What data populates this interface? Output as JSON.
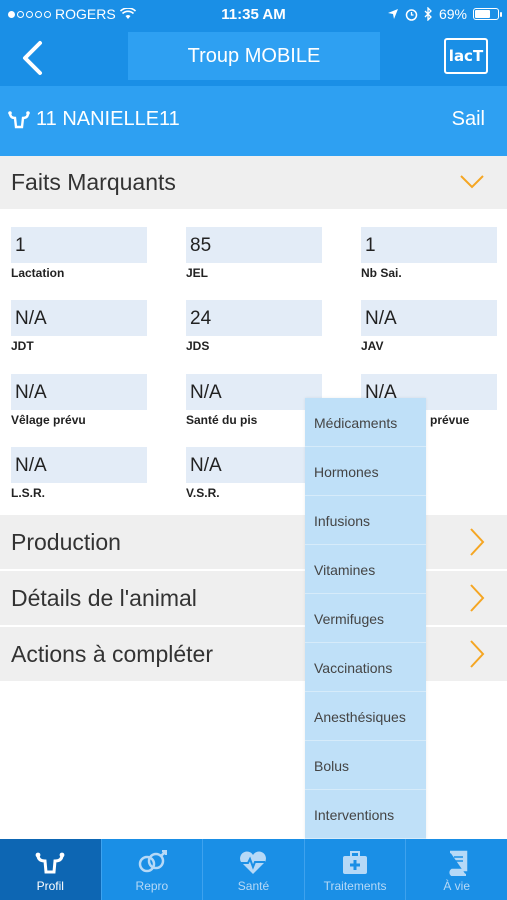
{
  "status_bar": {
    "carrier": "ROGERS",
    "time": "11:35 AM",
    "battery": "69%",
    "battery_level": 0.69
  },
  "nav": {
    "title": "Troup MOBILE",
    "logo_text": "lacT"
  },
  "animal": {
    "name": "11 NANIELLE11",
    "status": "Sail"
  },
  "faits": {
    "title": "Faits Marquants",
    "fields": [
      {
        "value": "1",
        "label": "Lactation"
      },
      {
        "value": "85",
        "label": "JEL"
      },
      {
        "value": "1",
        "label": "Nb Sai."
      },
      {
        "value": "N/A",
        "label": "JDT"
      },
      {
        "value": "24",
        "label": "JDS"
      },
      {
        "value": "N/A",
        "label": "JAV"
      },
      {
        "value": "N/A",
        "label": "Vêlage prévu"
      },
      {
        "value": "N/A",
        "label": "Santé du pis"
      },
      {
        "value": "N/A",
        "label": "prévue"
      },
      {
        "value": "N/A",
        "label": "L.S.R."
      },
      {
        "value": "N/A",
        "label": "V.S.R."
      }
    ]
  },
  "sections": [
    {
      "label": "Production"
    },
    {
      "label": "Détails de l'animal"
    },
    {
      "label": "Actions à compléter"
    }
  ],
  "dropdown": {
    "items": [
      "Médicaments",
      "Hormones",
      "Infusions",
      "Vitamines",
      "Vermifuges",
      "Vaccinations",
      "Anesthésiques",
      "Bolus",
      "Interventions"
    ]
  },
  "tabs": [
    {
      "label": "Profil",
      "icon": "uterus-icon"
    },
    {
      "label": "Repro",
      "icon": "gender-icon"
    },
    {
      "label": "Santé",
      "icon": "heart-pulse-icon"
    },
    {
      "label": "Traitements",
      "icon": "medkit-icon"
    },
    {
      "label": "À vie",
      "icon": "book-icon"
    }
  ],
  "colors": {
    "primary": "#1a8fe6",
    "secondary": "#2ea0f2",
    "accent": "#f5a623",
    "field_bg": "#e3ecf7",
    "dropdown_bg": "#bfe0f8"
  }
}
